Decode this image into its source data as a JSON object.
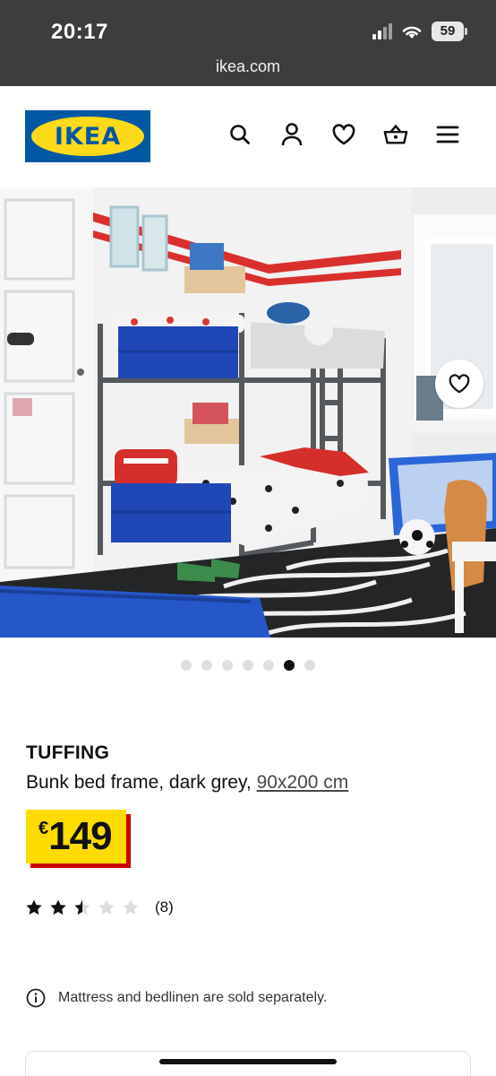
{
  "status": {
    "time": "20:17",
    "battery": "59"
  },
  "browser": {
    "url": "ikea.com"
  },
  "header": {
    "logo_text": "IKEA",
    "icons": [
      "search-icon",
      "account-icon",
      "heart-icon",
      "basket-icon",
      "menu-icon"
    ]
  },
  "gallery": {
    "active_index": 5,
    "count": 7
  },
  "product": {
    "name": "TUFFING",
    "description": "Bunk bed frame, dark grey, ",
    "size": "90x200 cm",
    "currency": "€",
    "price": "149",
    "rating": 2.5,
    "rating_max": 5,
    "review_count": "(8)",
    "note": "Mattress and bedlinen are sold separately."
  },
  "colors": {
    "brand_blue": "#0058a3",
    "brand_yellow": "#ffdb00",
    "price_shadow": "#cc0008"
  }
}
